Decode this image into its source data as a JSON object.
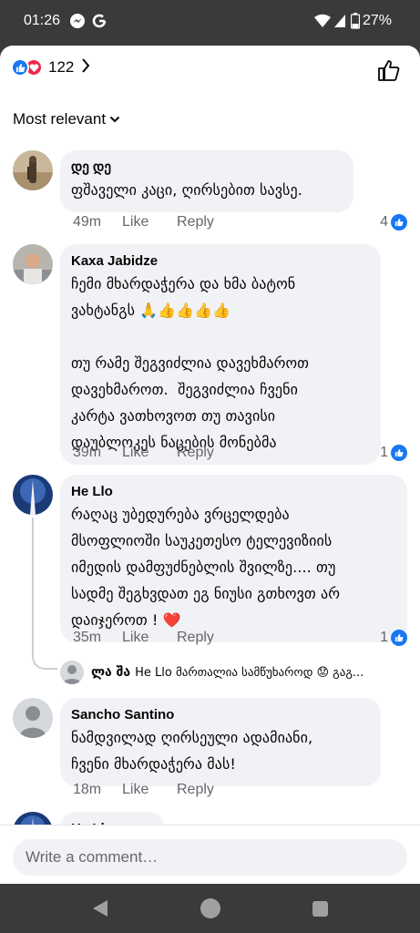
{
  "status_bar": {
    "time": "01:26",
    "battery": "27%"
  },
  "header": {
    "reaction_count": "122"
  },
  "sort": {
    "label": "Most relevant"
  },
  "comments": [
    {
      "name": "დე დე",
      "text": "ფშაველი კაცი, ღირსებით სავსე.",
      "time": "49m",
      "like_label": "Like",
      "reply_label": "Reply",
      "likes": "4"
    },
    {
      "name": "Kaxa Jabidze",
      "text": "ჩემი მხარდაჭერა და ხმა ბატონ\nვახტანგს 🙏👍👍👍👍\n\nთუ რამე შეგვიძლია დავეხმაროთ\nდავეხმაროთ.  შეგვიძლია ჩვენი\nკარტა ვათხოვოთ თუ თავისი\nდაუბლოკეს ნაცების მონებმა",
      "time": "39m",
      "like_label": "Like",
      "reply_label": "Reply",
      "likes": "1"
    },
    {
      "name": "He Llo",
      "text": "რაღაც უბედურება ვრცელდება\nმსოფლიოში საუკეთესო ტელევიზიის\nიმედის დამფუძნებლის შვილზე.... თუ\nსადმე შეგხვდათ ეგ ნიუსი გთხოვთ არ\nდაიჯეროთ ! ❤️",
      "time": "35m",
      "like_label": "Like",
      "reply_label": "Reply",
      "likes": "1"
    },
    {
      "name": "Sancho  Santino",
      "text": "ნამდვილად ღირსეული ადამიანი,\nჩვენი მხარდაჭერა მას!",
      "time": "18m",
      "like_label": "Like",
      "reply_label": "Reply"
    },
    {
      "name": "He Llo"
    }
  ],
  "reply_preview": {
    "name": "ლა შა",
    "text": "He Llo მართალია სამწუხაროდ 😟 გაგ..."
  },
  "composer": {
    "placeholder": "Write a comment…"
  },
  "colors": {
    "accent": "#1877f2",
    "love": "#f0284a",
    "bubble": "#f0f2f5",
    "meta": "#65676b"
  }
}
